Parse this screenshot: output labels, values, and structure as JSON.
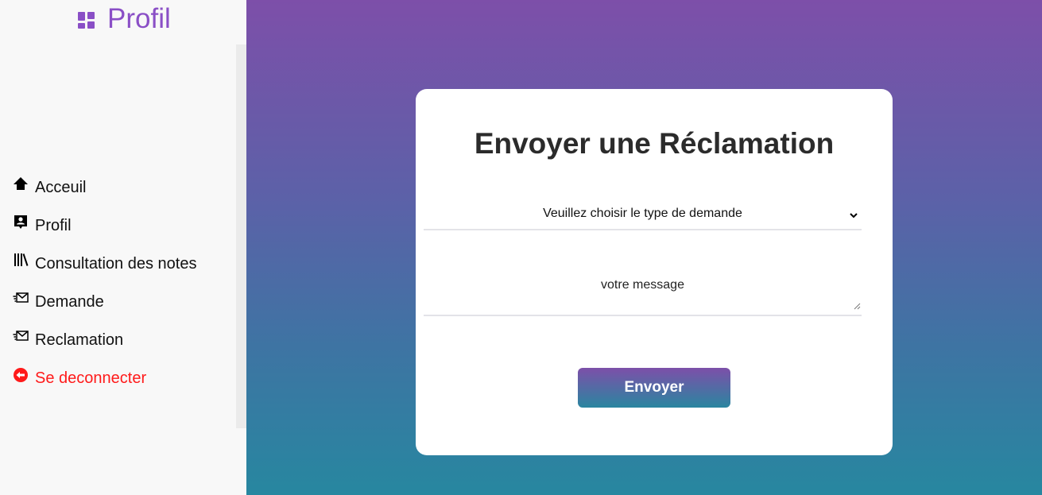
{
  "sidebar": {
    "brand": {
      "label": "Profil",
      "icon": "dashboard-icon",
      "color": "#8a4fc6"
    },
    "items": [
      {
        "label": "Acceuil",
        "icon": "home-icon"
      },
      {
        "label": "Profil",
        "icon": "profile-badge-icon"
      },
      {
        "label": "Consultation des notes",
        "icon": "library-icon"
      },
      {
        "label": "Demande",
        "icon": "mail-send-icon"
      },
      {
        "label": "Reclamation",
        "icon": "mail-send-icon"
      },
      {
        "label": "Se deconnecter",
        "icon": "logout-icon",
        "color": "#ff1a1a"
      }
    ]
  },
  "main": {
    "background_gradient": [
      "#7d4fa9",
      "#2787a0"
    ],
    "form": {
      "title": "Envoyer une Réclamation",
      "type_select": {
        "selected": "Veuillez choisir le type de demande"
      },
      "message": {
        "placeholder": "votre message"
      },
      "submit_label": "Envoyer"
    }
  }
}
